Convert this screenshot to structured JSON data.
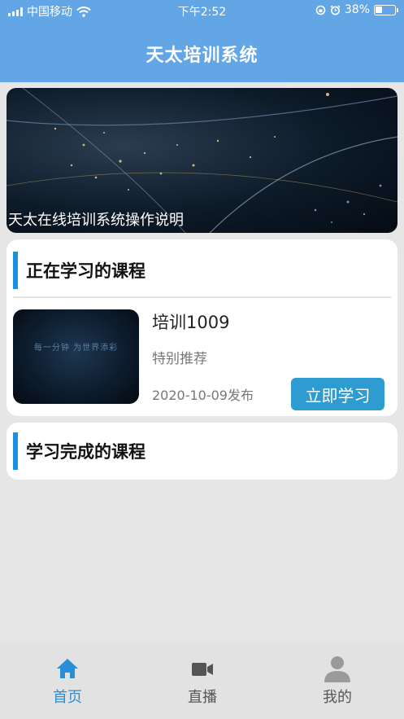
{
  "status_bar": {
    "carrier": "中国移动",
    "time": "下午2:52",
    "battery": "38%",
    "battery_level": 0.38
  },
  "header": {
    "title": "天太培训系统"
  },
  "banner": {
    "caption": "天太在线培训系统操作说明"
  },
  "current_section": {
    "title": "正在学习的课程",
    "courses": [
      {
        "thumb_text": "每一分钟  为世界添彩",
        "name": "培训1009",
        "tag": "特别推荐",
        "date": "2020-10-09发布",
        "action": "立即学习"
      }
    ]
  },
  "done_section": {
    "title": "学习完成的课程"
  },
  "tabbar": {
    "items": [
      {
        "label": "首页",
        "icon": "home-icon",
        "active": true
      },
      {
        "label": "直播",
        "icon": "video-camera-icon",
        "active": false
      },
      {
        "label": "我的",
        "icon": "user-icon",
        "active": false
      }
    ],
    "active_color": "#2a8ed6",
    "inactive_color": "#555555"
  },
  "colors": {
    "header": "#63a6e6",
    "accent": "#1e90e0",
    "button": "#2e9bd1"
  }
}
